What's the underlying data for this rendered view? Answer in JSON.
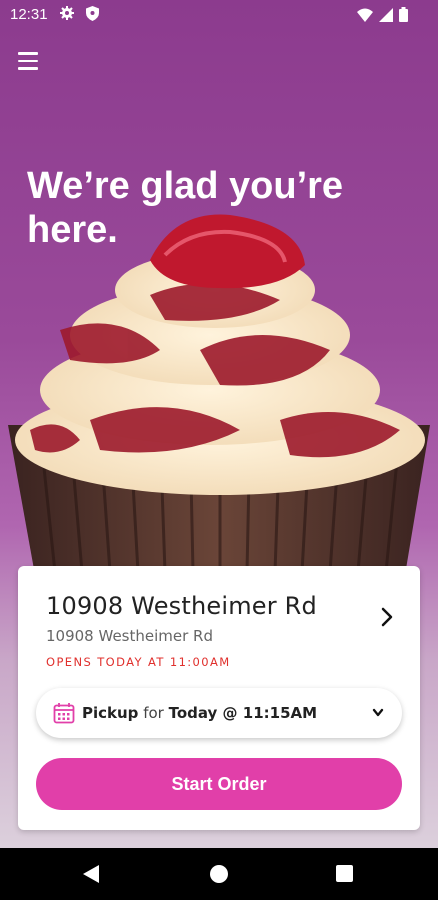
{
  "status_bar": {
    "time": "12:31",
    "icons": [
      "gear-icon",
      "shield-icon",
      "wifi-icon",
      "signal-icon",
      "battery-icon"
    ]
  },
  "header": {
    "menu_icon": "hamburger-icon",
    "headline": "We’re glad you’re here."
  },
  "store_card": {
    "name": "10908 Westheimer Rd",
    "address": "10908 Westheimer Rd",
    "hours": "OPENS TODAY AT 11:00AM",
    "hours_color": "#e0302d",
    "chevron_icon": "chevron-right-icon"
  },
  "pickup": {
    "icon": "calendar-icon",
    "method": "Pickup",
    "connector": "for",
    "time": "Today @ 11:15AM",
    "dropdown_icon": "chevron-down-icon"
  },
  "cta": {
    "label": "Start Order",
    "color": "#e13fa9"
  },
  "nav_bar": {
    "icons": [
      "back-icon",
      "home-icon",
      "recents-icon"
    ]
  }
}
